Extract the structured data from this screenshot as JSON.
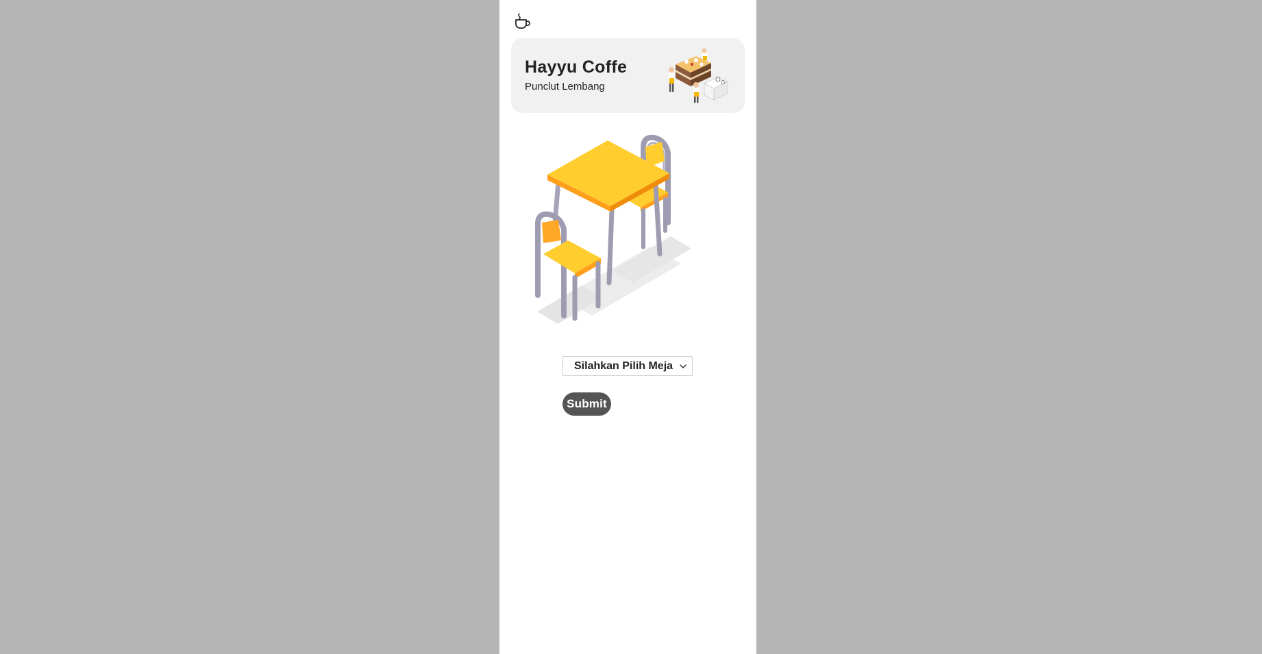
{
  "app": {
    "logo_icon": "coffee-cup-icon"
  },
  "header": {
    "title": "Hayyu Coffe",
    "subtitle": "Punclut Lembang",
    "illustration": "baristas-cake-illustration"
  },
  "main": {
    "illustration": "table-chairs-illustration",
    "table_select": {
      "selected_label": "Silahkan Pilih Meja",
      "icon": "chevron-down-icon"
    },
    "submit_label": "Submit"
  },
  "colors": {
    "backdrop": "#b5b5b5",
    "card": "#f1f1f1",
    "table_top": "#ffcd2e",
    "chair_seat": "#ffa726",
    "frame": "#9e9cb0",
    "button": "#555555"
  }
}
